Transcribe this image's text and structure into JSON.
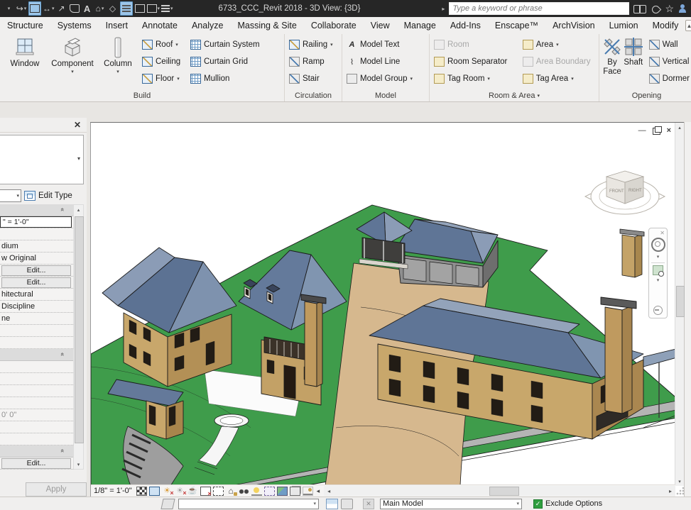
{
  "title_bar": {
    "title": "6733_CCC_Revit 2018 - 3D View: {3D}",
    "search_placeholder": "Type a keyword or phrase"
  },
  "tabs": [
    "Structure",
    "Systems",
    "Insert",
    "Annotate",
    "Analyze",
    "Massing & Site",
    "Collaborate",
    "View",
    "Manage",
    "Add-Ins",
    "Enscape™",
    "ArchVision",
    "Lumion",
    "Modify"
  ],
  "ribbon": {
    "build": {
      "label": "Build",
      "window": "Window",
      "component": "Component",
      "column": "Column",
      "roof": "Roof",
      "ceiling": "Ceiling",
      "floor": "Floor",
      "curtain_system": "Curtain System",
      "curtain_grid": "Curtain Grid",
      "mullion": "Mullion"
    },
    "circulation": {
      "label": "Circulation",
      "railing": "Railing",
      "ramp": "Ramp",
      "stair": "Stair"
    },
    "model": {
      "label": "Model",
      "text": "Model Text",
      "line": "Model Line",
      "group": "Model Group"
    },
    "room_area": {
      "label": "Room & Area",
      "room": "Room",
      "room_separator": "Room Separator",
      "tag_room": "Tag Room",
      "area": "Area",
      "area_boundary": "Area Boundary",
      "tag_area": "Tag Area"
    },
    "opening": {
      "label": "Opening",
      "by_face": "By Face",
      "shaft": "Shaft",
      "wall": "Wall",
      "vertical": "Vertical",
      "dormer": "Dormer"
    }
  },
  "properties": {
    "edit_type": "Edit Type",
    "apply": "Apply",
    "rows": {
      "view_scale": "\" = 1'-0\"",
      "detail_level": "dium",
      "parts_visibility": "w Original",
      "vg_overrides": "Edit...",
      "graphic_display_options": "Edit...",
      "discipline": "hitectural",
      "show_hidden_lines": "Discipline",
      "default_analysis_display": "ne",
      "elevation": "0' 0\"",
      "edit": "Edit..."
    }
  },
  "viewport": {
    "viewcube": {
      "front": "FRONT",
      "right": "RIGHT"
    }
  },
  "view_control_bar": {
    "scale": "1/8\" = 1'-0\""
  },
  "status_bar": {
    "main_model": "Main Model",
    "exclude_options": "Exclude Options"
  }
}
